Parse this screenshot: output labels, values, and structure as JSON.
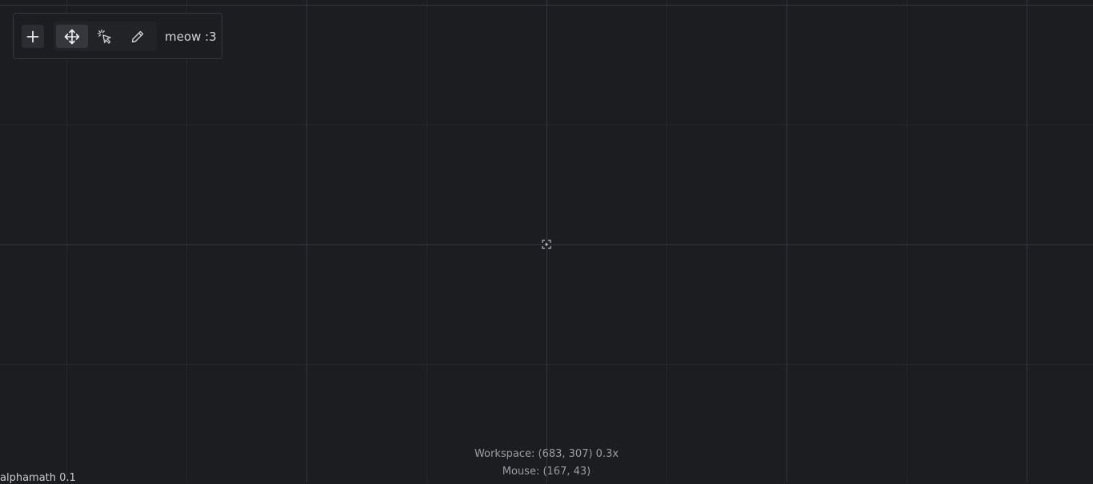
{
  "toolbar": {
    "add_icon": "plus-icon",
    "tools": [
      {
        "name": "move-tool",
        "icon": "move-arrows-icon",
        "active": true
      },
      {
        "name": "select-tool",
        "icon": "cursor-click-icon",
        "active": false
      },
      {
        "name": "draw-tool",
        "icon": "pencil-icon",
        "active": false
      }
    ],
    "project_name": "meow :3"
  },
  "workspace": {
    "center_icon": "focus-center-icon"
  },
  "status": {
    "workspace": "Workspace: (683, 307) 0.3x",
    "mouse": "Mouse: (167, 43)"
  },
  "app": {
    "version": "alphamath 0.1"
  },
  "colors": {
    "background": "#1c1d21",
    "grid_major": "#34363b",
    "grid_minor": "#25262a",
    "text": "#d4d5d8",
    "text_muted": "#9b9da1",
    "active_tool": "#35373c"
  }
}
